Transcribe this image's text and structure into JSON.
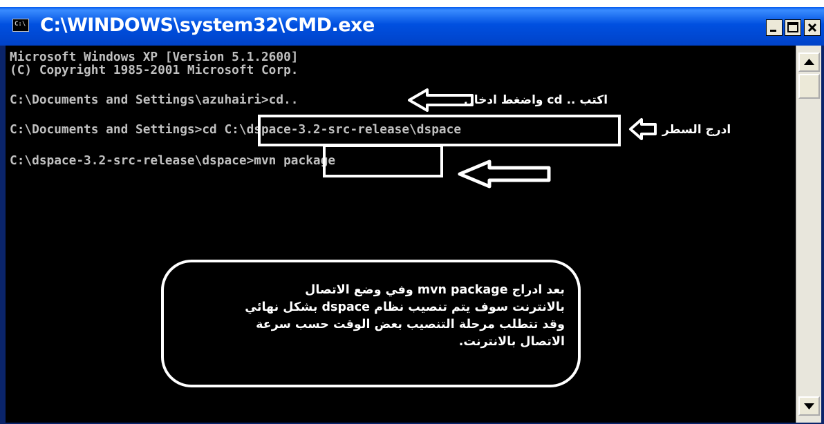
{
  "window": {
    "title": "C:\\WINDOWS\\system32\\CMD.exe",
    "app_icon_text": "C:\\",
    "controls": [
      "minimize",
      "maximize",
      "close"
    ]
  },
  "console": {
    "lines": [
      "Microsoft Windows XP [Version 5.1.2600]",
      "(C) Copyright 1985-2001 Microsoft Corp.",
      "C:\\Documents and Settings\\azuhairi>cd..",
      "C:\\Documents and Settings>cd C:\\dspace-3.2-src-release\\dspace",
      "C:\\dspace-3.2-src-release\\dspace>mvn package"
    ]
  },
  "annotations": {
    "note1": "اكتب .. cd واضغط ادخال",
    "note2": "ادرج السطر",
    "callout_lines": [
      "بعد ادراج mvn package وفي وضع الاتصال",
      "بالانترنت سوف يتم تنصيب نظام dspace بشكل نهائي",
      "وقد تتطلب مرحلة التنصيب بعض الوقت حسب سرعة",
      "الاتصال بالانترنت."
    ]
  },
  "colors": {
    "titlebar": "#0050e0",
    "console_bg": "#000000",
    "console_text": "#c0c0c0",
    "annotation": "#ffffff"
  }
}
